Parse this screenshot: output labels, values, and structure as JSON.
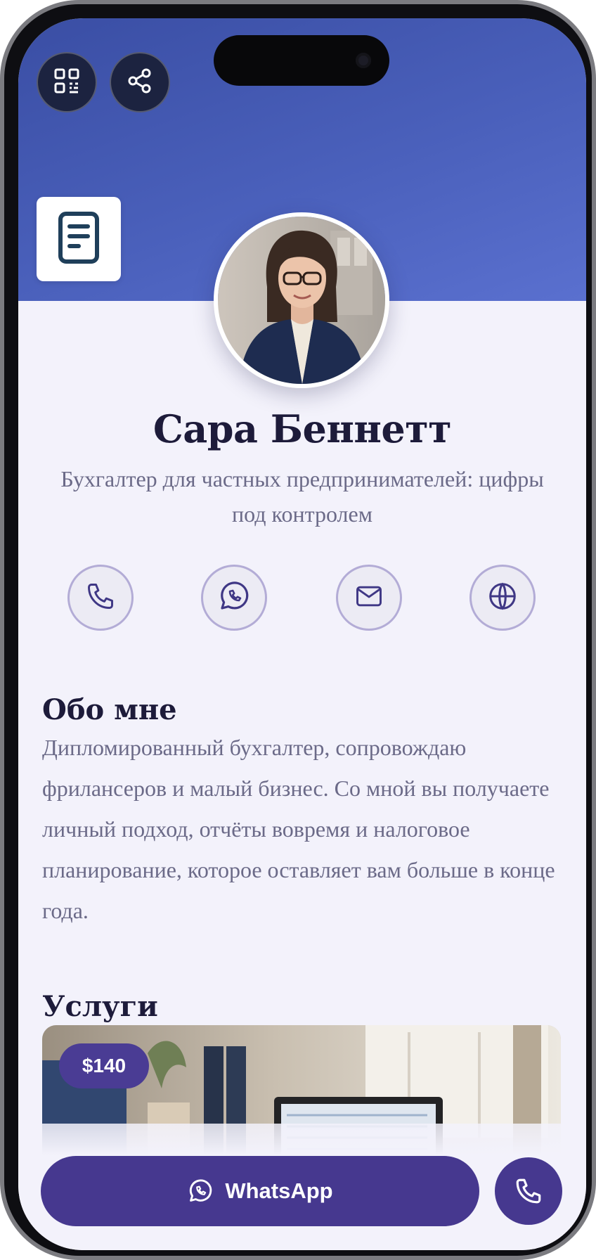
{
  "profile": {
    "name": "Сара Беннетт",
    "tagline": "Бухгалтер для частных предпринимателей: цифры под контролем"
  },
  "header": {
    "qr_icon": "qr-code-icon",
    "share_icon": "share-icon",
    "document_icon": "document-icon"
  },
  "contacts": [
    {
      "icon": "phone-icon"
    },
    {
      "icon": "whatsapp-icon"
    },
    {
      "icon": "mail-icon"
    },
    {
      "icon": "globe-icon"
    }
  ],
  "about": {
    "title": "Обо мне",
    "text": "Дипломированный бухгалтер, сопровождаю фрилансеров и малый бизнес. Со мной вы получаете личный подход, отчёты вовремя и налоговое планирование, которое оставляет вам больше в конце года."
  },
  "services": {
    "title": "Услуги",
    "items": [
      {
        "price": "$140"
      }
    ]
  },
  "actions": {
    "whatsapp_label": "WhatsApp",
    "call_icon": "phone-icon"
  },
  "colors": {
    "hero": "#4a60bb",
    "primary": "#46388f",
    "background": "#f3f2fb",
    "heading": "#1d1b3a",
    "muted_text": "#6b6a88"
  }
}
